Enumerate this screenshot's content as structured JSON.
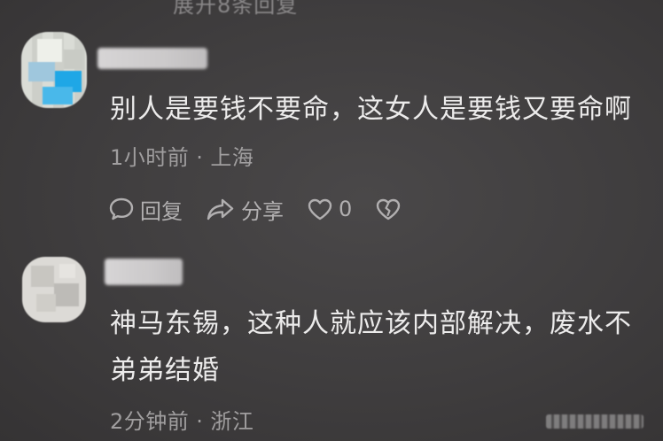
{
  "top_hint": "展开8条回复",
  "comments": [
    {
      "text": "别人是要钱不要命，这女人是要钱又要命啊",
      "time": "1小时前",
      "location": "上海",
      "actions": {
        "reply_label": "回复",
        "share_label": "分享",
        "like_count": "0"
      }
    },
    {
      "text_line1": "神马东锡，这种人就应该内部解决，废水不",
      "text_line2": "弟弟结婚",
      "time": "2分钟前",
      "location": "浙江"
    }
  ],
  "separator": "·",
  "icons": {
    "reply": "comment-bubble-icon",
    "share": "share-arrow-icon",
    "like": "heart-icon",
    "dislike": "broken-heart-icon"
  }
}
